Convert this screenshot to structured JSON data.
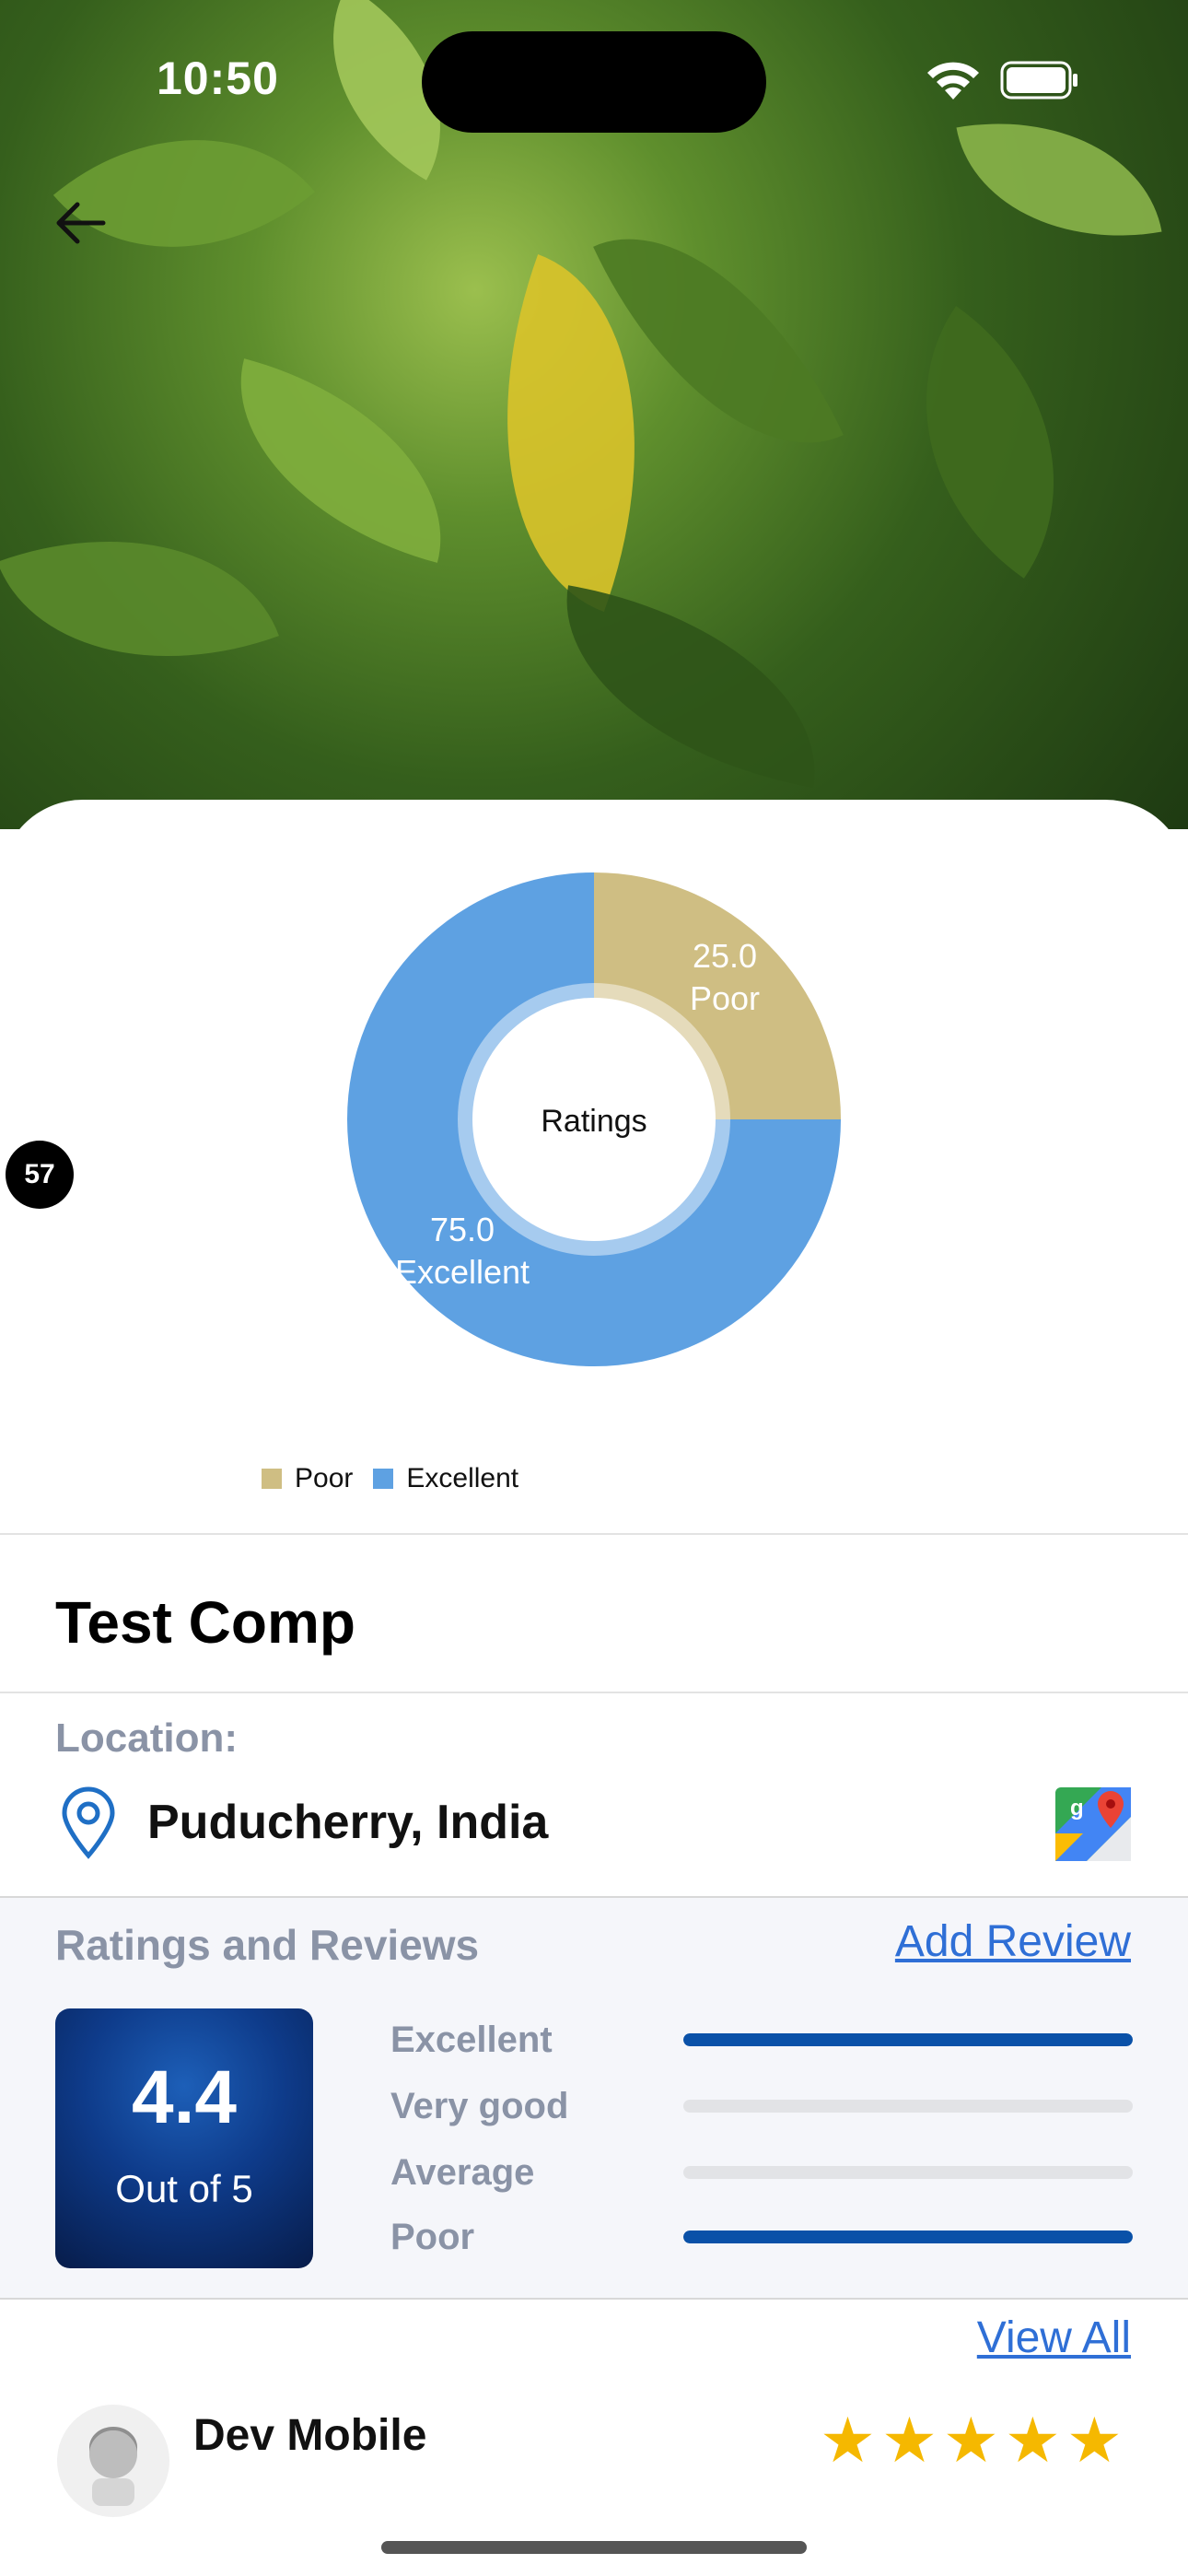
{
  "status_bar": {
    "time": "10:50"
  },
  "chart_data": {
    "type": "pie",
    "center_label": "Ratings",
    "slices": [
      {
        "label": "Poor",
        "value": 25.0,
        "color": "#cfbe83"
      },
      {
        "label": "Excellent",
        "value": 75.0,
        "color": "#5ea1e2"
      }
    ],
    "legend": [
      "Poor",
      "Excellent"
    ],
    "legend_position": "bottom"
  },
  "chart_labels": {
    "poor_value": "25.0",
    "poor_name": "Poor",
    "excellent_value": "75.0",
    "excellent_name": "Excellent"
  },
  "legend": {
    "poor": "Poor",
    "excellent": "Excellent"
  },
  "side_badge": "57",
  "company": {
    "name": "Test Comp"
  },
  "location": {
    "label": "Location:",
    "value": "Puducherry, India"
  },
  "reviews": {
    "title": "Ratings and Reviews",
    "add_review": "Add Review",
    "score": "4.4",
    "score_sub": "Out of 5",
    "bars": [
      {
        "label": "Excellent",
        "fill": 1.0
      },
      {
        "label": "Very good",
        "fill": 0.0
      },
      {
        "label": "Average",
        "fill": 0.0
      },
      {
        "label": "Poor",
        "fill": 1.0
      }
    ],
    "view_all": "View All",
    "reviewer_name": "Dev Mobile",
    "stars": "★★★★★",
    "star_count": 5
  },
  "icons": {
    "back": "arrow-left-icon",
    "pin": "location-pin-icon",
    "maps": "google-maps-icon",
    "avatar": "user-avatar-icon",
    "star": "star-icon"
  }
}
